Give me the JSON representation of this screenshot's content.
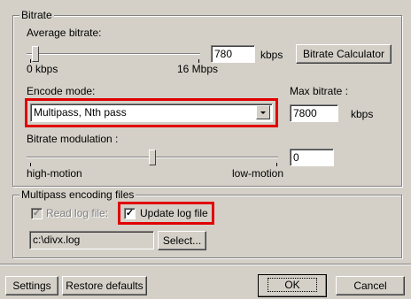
{
  "bitrate": {
    "group_label": "Bitrate",
    "avg_label": "Average bitrate:",
    "avg_value": "780",
    "avg_unit": "kbps",
    "calc_button": "Bitrate Calculator",
    "min_label": "0 kbps",
    "max_label": "16 Mbps",
    "avg_slider_level": 0.05,
    "encode_mode_label": "Encode mode:",
    "encode_mode_value": "Multipass, Nth pass",
    "max_bitrate_label": "Max bitrate :",
    "max_bitrate_value": "7800",
    "max_bitrate_unit": "kbps",
    "modulation_label": "Bitrate modulation :",
    "modulation_value": "0",
    "modulation_left": "high-motion",
    "modulation_right": "low-motion",
    "modulation_slider_level": 0.5
  },
  "multipass": {
    "group_label": "Multipass encoding files",
    "read_log_label": "Read log file:",
    "read_log_checked": true,
    "update_log_label": "Update log file",
    "update_log_checked": true,
    "log_path": "c:\\divx.log",
    "select_button": "Select..."
  },
  "footer": {
    "settings_button": "Settings",
    "restore_button": "Restore defaults",
    "ok_button": "OK",
    "cancel_button": "Cancel"
  },
  "colors": {
    "highlight": "#e00000",
    "window_bg": "#d4d0c8"
  }
}
